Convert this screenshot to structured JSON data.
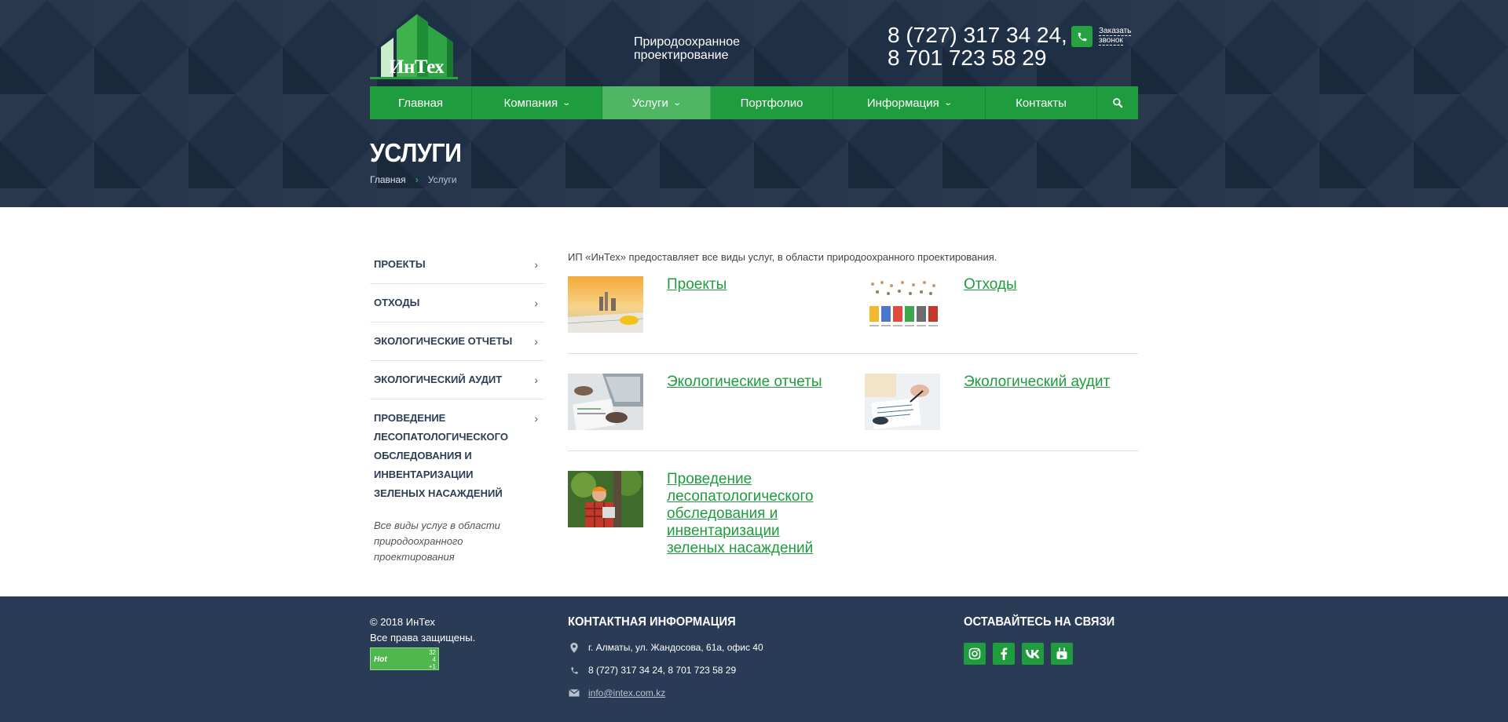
{
  "header": {
    "logo_text": "ИнТех",
    "tagline": "Природоохранное проектирование",
    "phones": [
      "8 (727) 317 34 24,",
      "8 701 723 58 29"
    ],
    "callback_lines": [
      "Заказать",
      "звонок"
    ]
  },
  "nav": [
    {
      "label": "Главная",
      "dropdown": false
    },
    {
      "label": "Компания",
      "dropdown": true
    },
    {
      "label": "Услуги",
      "dropdown": true,
      "active": true
    },
    {
      "label": "Портфолио",
      "dropdown": false
    },
    {
      "label": "Информация",
      "dropdown": true
    },
    {
      "label": "Контакты",
      "dropdown": false
    }
  ],
  "page": {
    "title": "УСЛУГИ",
    "breadcrumb": [
      "Главная",
      "Услуги"
    ]
  },
  "sidebar": {
    "items": [
      "ПРОЕКТЫ",
      "ОТХОДЫ",
      "ЭКОЛОГИЧЕСКИЕ ОТЧЕТЫ",
      "ЭКОЛОГИЧЕСКИЙ АУДИТ",
      "ПРОВЕДЕНИЕ ЛЕСОПАТОЛОГИЧЕСКОГО ОБСЛЕДОВАНИЯ И ИНВЕНТАРИЗАЦИИ ЗЕЛЕНЫХ НАСАЖДЕНИЙ"
    ],
    "note": "Все виды услуг в области природоохранного проектирования"
  },
  "content": {
    "intro": "ИП «ИнТех» предоставляет все виды услуг, в области природоохранного проектирования.",
    "services": [
      "Проекты",
      "Отходы",
      "Экологические отчеты",
      "Экологический аудит",
      "Проведение лесопатологического обследования и инвентаризации зеленых насаждений"
    ]
  },
  "footer": {
    "copyright": "© 2018 ИнТех",
    "rights": "Все права защищены.",
    "counter": {
      "label": "Hot",
      "nums": [
        "32",
        "4",
        "+1"
      ]
    },
    "contact_heading": "КОНТАКТНАЯ ИНФОРМАЦИЯ",
    "address": "г. Алматы, ул. Жандосова, 61а, офис 40",
    "phones": "8 (727) 317 34 24, 8 701 723 58 29",
    "email": "info@intex.com.kz",
    "social_heading": "ОСТАВАЙТЕСЬ НА СВЯЗИ",
    "socials": [
      "instagram",
      "facebook",
      "vk",
      "youtube"
    ]
  },
  "colors": {
    "brand_green": "#1f9c3e",
    "header_bg": "#1f2f45",
    "footer_bg": "#2a3c55"
  }
}
